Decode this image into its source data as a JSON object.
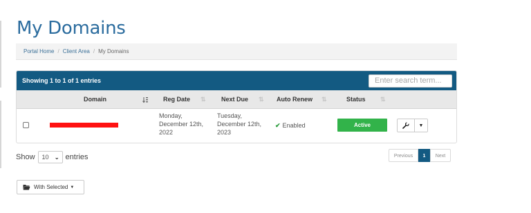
{
  "page": {
    "title": "My Domains"
  },
  "breadcrumb": [
    {
      "label": "Portal Home"
    },
    {
      "label": "Client Area"
    },
    {
      "label": "My Domains"
    }
  ],
  "breadcrumb_separator": "/",
  "table_header": {
    "info": "Showing 1 to 1 of 1 entries",
    "search_placeholder": "Enter search term..."
  },
  "columns": {
    "domain": "Domain",
    "reg_date": "Reg Date",
    "next_due": "Next Due",
    "auto_renew": "Auto Renew",
    "status": "Status"
  },
  "rows": [
    {
      "domain_redacted": true,
      "reg_date": [
        "Monday,",
        "December 12th,",
        "2022"
      ],
      "next_due": [
        "Tuesday,",
        "December 12th,",
        "2023"
      ],
      "auto_renew": "Enabled",
      "status": "Active",
      "status_color": "#32b34a"
    }
  ],
  "length_menu": {
    "prefix": "Show",
    "value": "10",
    "suffix": "entries"
  },
  "pagination": {
    "previous": "Previous",
    "current": "1",
    "next": "Next"
  },
  "bulk_action": {
    "label": "With Selected"
  },
  "colors": {
    "header_bg": "#135a82",
    "title": "#2b6c9e",
    "accent": "#135a82",
    "redaction": "#ff1111"
  },
  "icons": {
    "wrench": "wrench-icon",
    "dropdown": "caret-down-icon",
    "sort": "sort-icon",
    "sort_active": "sort-alpha-asc-icon",
    "check": "check-icon",
    "folder": "folder-open-icon"
  }
}
